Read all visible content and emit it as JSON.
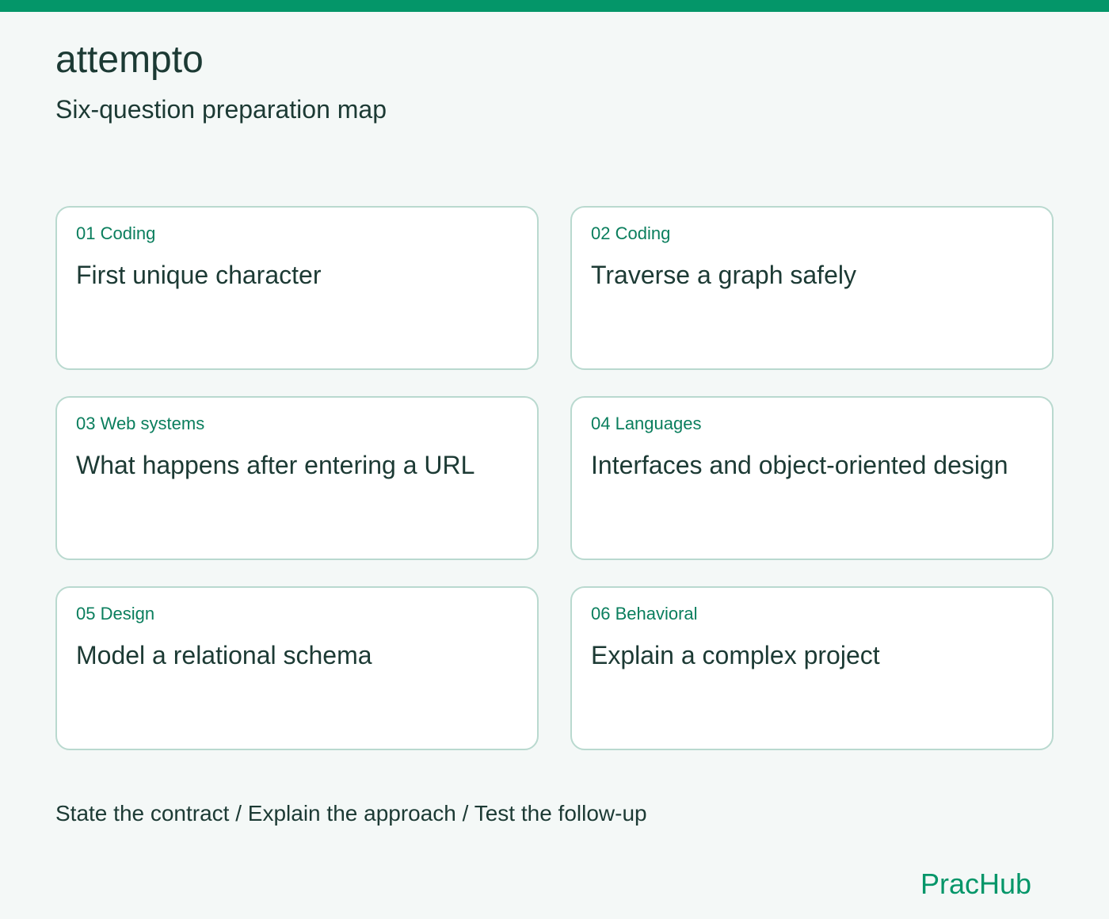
{
  "header": {
    "brand": "attempto",
    "subtitle": "Six-question preparation map"
  },
  "cards": [
    {
      "tag": "01 Coding",
      "title": "First unique character"
    },
    {
      "tag": "02 Coding",
      "title": "Traverse a graph safely"
    },
    {
      "tag": "03 Web systems",
      "title": "What happens after entering a URL"
    },
    {
      "tag": "04 Languages",
      "title": "Interfaces and object-oriented design"
    },
    {
      "tag": "05 Design",
      "title": "Model a relational schema"
    },
    {
      "tag": "06 Behavioral",
      "title": "Explain a complex project"
    }
  ],
  "footer": {
    "steps": "State the contract / Explain the approach / Test the follow-up",
    "logo": "PracHub"
  },
  "colors": {
    "accent": "#049669",
    "background": "#f4f8f7",
    "card_border": "#b9d9cf",
    "text": "#1c3a34"
  }
}
